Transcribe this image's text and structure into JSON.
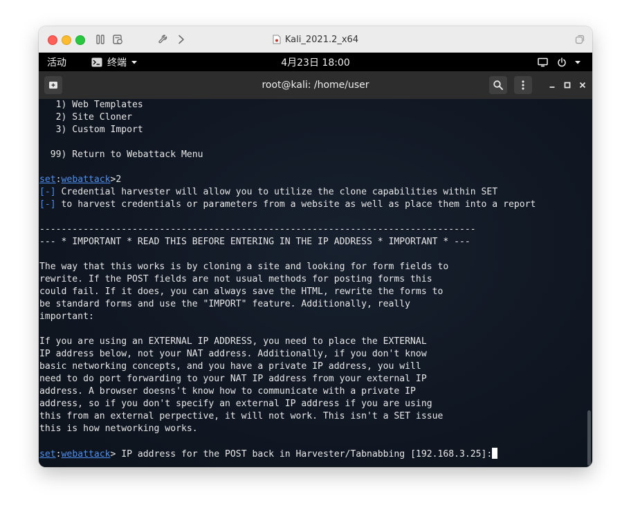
{
  "host": {
    "window_title": "Kali_2021.2_x64"
  },
  "gnome": {
    "activities": "活动",
    "app_menu": "终端",
    "datetime": "4月23日  18:00"
  },
  "terminal": {
    "title": "root@kali: /home/user",
    "lines": [
      {
        "t": "   1) Web Templates"
      },
      {
        "t": "   2) Site Cloner"
      },
      {
        "t": "   3) Custom Import"
      },
      {
        "t": ""
      },
      {
        "t": "  99) Return to Webattack Menu"
      },
      {
        "t": ""
      },
      {
        "prompt": true,
        "t": ">2"
      },
      {
        "tag": "[-]",
        "t": " Credential harvester will allow you to utilize the clone capabilities within SET"
      },
      {
        "tag": "[-]",
        "t": " to harvest credentials or parameters from a website as well as place them into a report"
      },
      {
        "t": ""
      },
      {
        "t": "--------------------------------------------------------------------------------"
      },
      {
        "t": "--- * IMPORTANT * READ THIS BEFORE ENTERING IN THE IP ADDRESS * IMPORTANT * ---"
      },
      {
        "t": ""
      },
      {
        "t": "The way that this works is by cloning a site and looking for form fields to"
      },
      {
        "t": "rewrite. If the POST fields are not usual methods for posting forms this"
      },
      {
        "t": "could fail. If it does, you can always save the HTML, rewrite the forms to"
      },
      {
        "t": "be standard forms and use the \"IMPORT\" feature. Additionally, really"
      },
      {
        "t": "important:"
      },
      {
        "t": ""
      },
      {
        "t": "If you are using an EXTERNAL IP ADDRESS, you need to place the EXTERNAL"
      },
      {
        "t": "IP address below, not your NAT address. Additionally, if you don't know"
      },
      {
        "t": "basic networking concepts, and you have a private IP address, you will"
      },
      {
        "t": "need to do port forwarding to your NAT IP address from your external IP"
      },
      {
        "t": "address. A browser doesns't know how to communicate with a private IP"
      },
      {
        "t": "address, so if you don't specify an external IP address if you are using"
      },
      {
        "t": "this from an external perpective, it will not work. This isn't a SET issue"
      },
      {
        "t": "this is how networking works."
      },
      {
        "t": ""
      },
      {
        "prompt": true,
        "t": "> IP address for the POST back in Harvester/Tabnabbing [192.168.3.25]:",
        "cursor": true
      }
    ],
    "prompt_set": "set",
    "prompt_sep": ":",
    "prompt_module": "webattack"
  },
  "colors": {
    "terminal_bg": "#101722",
    "prompt_blue": "#4d8ff0",
    "text": "#e8e8e8"
  }
}
